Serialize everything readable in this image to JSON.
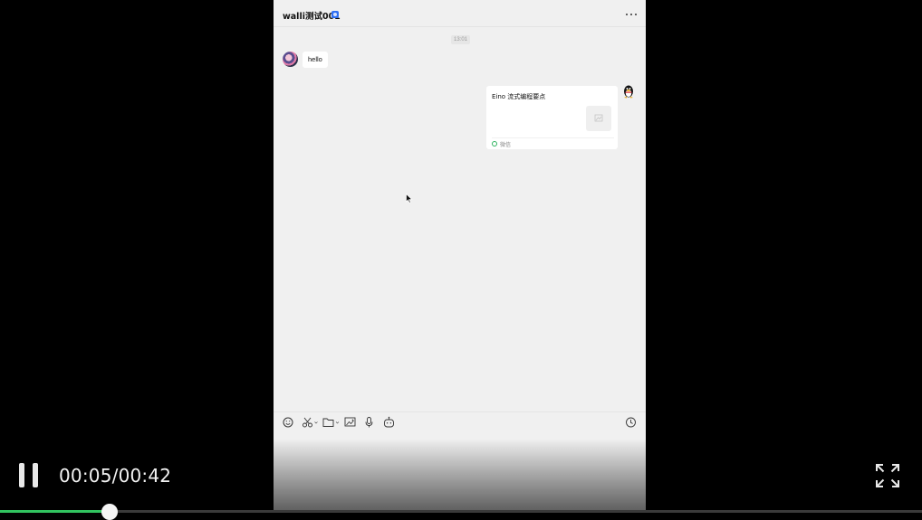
{
  "chat": {
    "title": "walli测试001",
    "time": "13:01",
    "messages": {
      "incoming_text": "hello"
    },
    "card": {
      "title": "Eino 流式编程要点",
      "source": "微信"
    }
  },
  "player": {
    "time_label": "00:05/00:42",
    "progress": 0.119
  },
  "colors": {
    "accent_green": "#31c35f",
    "badge_blue": "#2f6ff3",
    "chat_bg": "#f0f0f0"
  },
  "icons": [
    "verified-badge-icon",
    "more-icon",
    "emoji-icon",
    "scissors-icon",
    "folder-icon",
    "image-icon",
    "microphone-icon",
    "robot-icon",
    "history-icon",
    "pause-icon",
    "fullscreen-icon"
  ]
}
